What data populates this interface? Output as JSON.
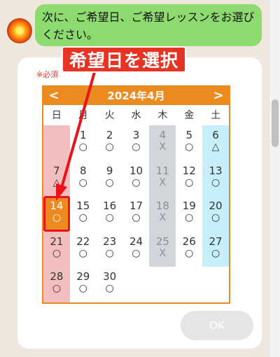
{
  "chat": {
    "message": "次に、ご希望日、ご希望レッスンをお選びください。"
  },
  "annotation": {
    "label": "希望日を選択",
    "color": "#e53324"
  },
  "form": {
    "required_label": "※必須",
    "ok_label": "OK"
  },
  "calendar": {
    "prev": "<",
    "next": ">",
    "title": "2024年4月",
    "weekdays": [
      "日",
      "月",
      "火",
      "水",
      "木",
      "金",
      "土"
    ],
    "days": [
      {
        "num": "",
        "mark": ""
      },
      {
        "num": "1",
        "mark": "○"
      },
      {
        "num": "2",
        "mark": "○"
      },
      {
        "num": "3",
        "mark": "○"
      },
      {
        "num": "4",
        "mark": "X"
      },
      {
        "num": "5",
        "mark": "○"
      },
      {
        "num": "6",
        "mark": "△"
      },
      {
        "num": "7",
        "mark": "△"
      },
      {
        "num": "8",
        "mark": "○"
      },
      {
        "num": "9",
        "mark": "○"
      },
      {
        "num": "10",
        "mark": "○"
      },
      {
        "num": "11",
        "mark": "X"
      },
      {
        "num": "12",
        "mark": "○"
      },
      {
        "num": "13",
        "mark": "○"
      },
      {
        "num": "14",
        "mark": "○"
      },
      {
        "num": "15",
        "mark": "○"
      },
      {
        "num": "16",
        "mark": "○"
      },
      {
        "num": "17",
        "mark": "○"
      },
      {
        "num": "18",
        "mark": "X"
      },
      {
        "num": "19",
        "mark": "○"
      },
      {
        "num": "20",
        "mark": "○"
      },
      {
        "num": "21",
        "mark": "○"
      },
      {
        "num": "22",
        "mark": "○"
      },
      {
        "num": "23",
        "mark": "○"
      },
      {
        "num": "24",
        "mark": "○"
      },
      {
        "num": "25",
        "mark": "X"
      },
      {
        "num": "26",
        "mark": "○"
      },
      {
        "num": "27",
        "mark": "○"
      },
      {
        "num": "28",
        "mark": "○"
      },
      {
        "num": "29",
        "mark": "○"
      },
      {
        "num": "30",
        "mark": "○"
      },
      {
        "num": "",
        "mark": ""
      },
      {
        "num": "",
        "mark": ""
      },
      {
        "num": "",
        "mark": ""
      },
      {
        "num": "",
        "mark": ""
      }
    ],
    "selected": "14",
    "colors": {
      "accent": "#ec8a1f",
      "sunday": "#f3bebe",
      "saturday": "#c6eefb",
      "closed": "#d2d5da",
      "bubble": "#8ddb6f"
    }
  }
}
